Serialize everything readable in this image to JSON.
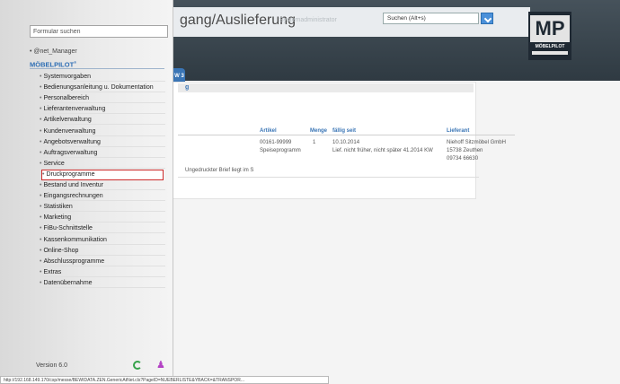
{
  "header": {
    "title": "gang/Auslieferung",
    "user": "Systemadministrator",
    "search_placeholder": "Suchen (Alt+s)",
    "logo_text": "MP",
    "logo_word": "MÖBELPILOT"
  },
  "side_tab": {
    "label": "W 3"
  },
  "panel": {
    "heading": "g",
    "columns": {
      "artikel": "Artikel",
      "menge": "Menge",
      "faellig": "fällig seit",
      "lieferant": "Lieferant"
    },
    "row": {
      "artikel_line1": "00161-99999",
      "artikel_line2": "Speiseprogramm",
      "menge": "1",
      "faellig_line1": "10.10.2014",
      "faellig_line2": "Lief. nicht früher, nicht später 41.2014 KW",
      "lieferant_line1": "Niehoff Sitzmöbel GmbH",
      "lieferant_line2": "15738 Zeuthen",
      "lieferant_line3": "09734 66630",
      "note": "Ungedruckter Brief liegt im S"
    }
  },
  "menu": {
    "search_placeholder": "Formular suchen",
    "root": "@net_Manager",
    "brand": "MÖBELPILOT",
    "brand_mark": "®",
    "items": [
      {
        "label": "Systemvorgaben"
      },
      {
        "label": "Bedienungsanleitung u. Dokumentation"
      },
      {
        "label": "Personalbereich"
      },
      {
        "label": "Lieferantenverwaltung"
      },
      {
        "label": "Artikelverwaltung"
      },
      {
        "label": "Kundenverwaltung"
      },
      {
        "label": "Angebotsverwaltung"
      },
      {
        "label": "Auftragsverwaltung"
      },
      {
        "label": "Service"
      },
      {
        "label": "Druckprogramme",
        "highlighted": true
      },
      {
        "label": "Bestand und Inventur"
      },
      {
        "label": "Eingangsrechnungen"
      },
      {
        "label": "Statistiken"
      },
      {
        "label": "Marketing"
      },
      {
        "label": "FiBu-Schnittstelle"
      },
      {
        "label": "Kassenkommunikation"
      },
      {
        "label": "Online-Shop"
      },
      {
        "label": "Abschlussprogramme"
      },
      {
        "label": "Extras"
      },
      {
        "label": "Datenübernahme"
      }
    ],
    "version": "Version 6.0"
  },
  "statusbar": {
    "url": "http://192.168.149.170/csp/messe/BEWIDATA.ZEN.GenericAtNet.cls?PageID=NUEBERLISTE&YBACK=&TRANSPOR..."
  },
  "colors": {
    "accent": "#3a75b5",
    "highlight_border": "#cd2a2a",
    "header_bg": "#2f3a42"
  },
  "icons": [
    "search-icon",
    "refresh-icon",
    "user-icon"
  ]
}
